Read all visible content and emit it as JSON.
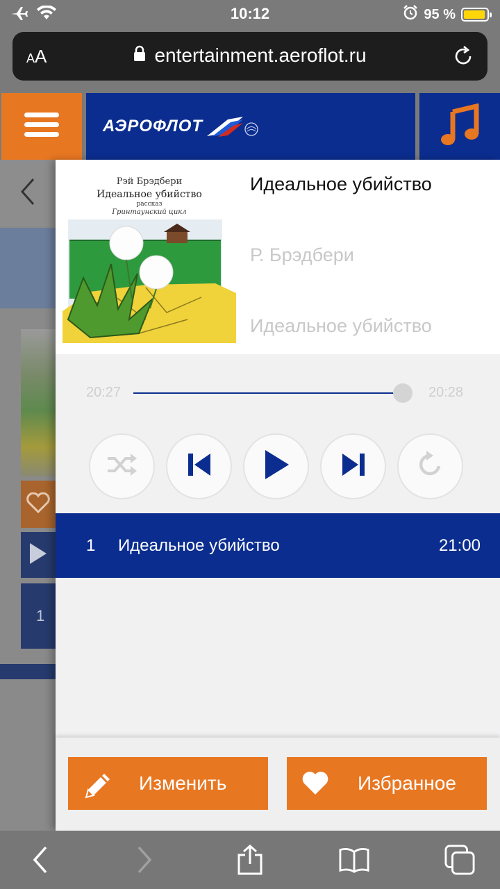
{
  "status_bar": {
    "time": "10:12",
    "battery_label": "95 %",
    "battery_level": 0.95,
    "icons": [
      "airplane-icon",
      "wifi-icon",
      "alarm-icon",
      "battery-icon"
    ]
  },
  "browser": {
    "text_size_label_small": "A",
    "text_size_label_large": "A",
    "url": "entertainment.aeroflot.ru",
    "icons": [
      "lock-icon",
      "reload-icon"
    ]
  },
  "header": {
    "brand": "АЭРОФЛОТ",
    "icons": [
      "menu-icon",
      "globe-icon",
      "music-note-icon"
    ],
    "colors": {
      "orange": "#e87722",
      "blue": "#0b2d8f"
    }
  },
  "background_page": {
    "track_number": "1",
    "icons": [
      "chevron-left-icon",
      "heart-icon",
      "play-icon"
    ]
  },
  "player": {
    "cover": {
      "author": "Рэй Брэдбери",
      "title": "Идеальное убийство",
      "subtitle": "рассказ",
      "cycle": "Гринтаунский цикл"
    },
    "title": "Идеальное убийство",
    "author": "Р. Брэдбери",
    "album": "Идеальное убийство",
    "elapsed": "20:27",
    "total": "20:28",
    "progress": 0.97,
    "controls": [
      "shuffle-icon",
      "previous-icon",
      "play-icon",
      "next-icon",
      "repeat-icon"
    ]
  },
  "playlist": [
    {
      "number": "1",
      "title": "Идеальное убийство",
      "duration": "21:00"
    }
  ],
  "actions": {
    "edit_label": "Изменить",
    "favorite_label": "Избранное"
  },
  "toolbar": {
    "icons": [
      "back-icon",
      "forward-icon",
      "share-icon",
      "bookmarks-icon",
      "tabs-icon"
    ]
  }
}
